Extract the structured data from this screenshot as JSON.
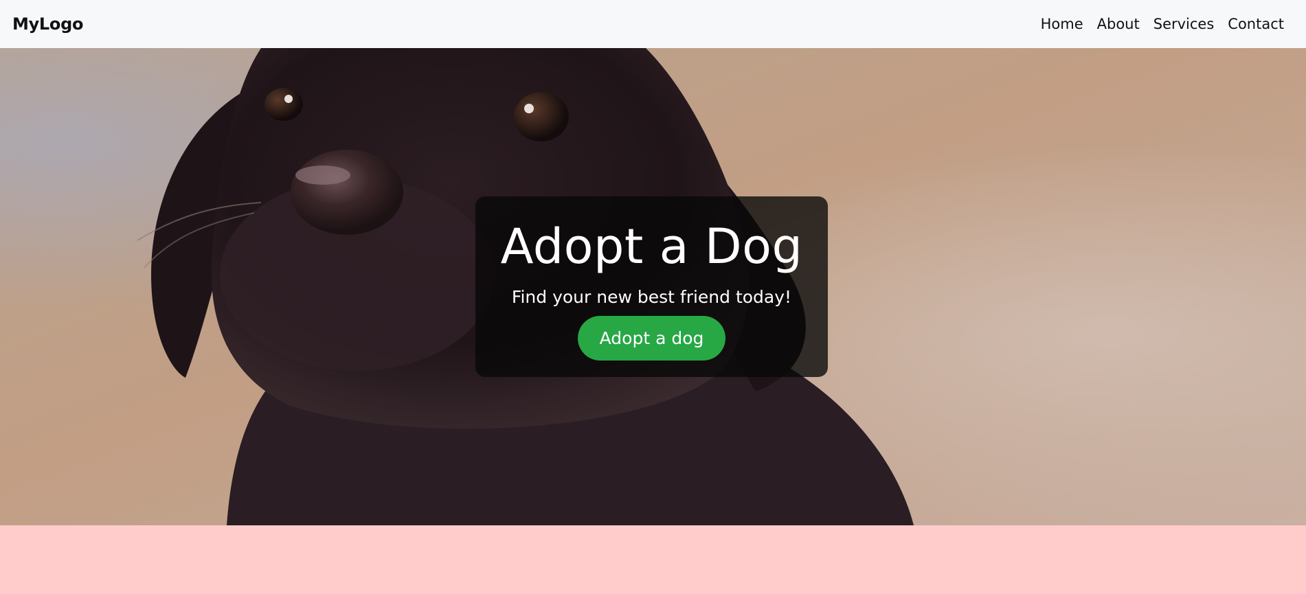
{
  "navbar": {
    "logo": "MyLogo",
    "links": [
      "Home",
      "About",
      "Services",
      "Contact"
    ]
  },
  "hero": {
    "image_alt": "black puppy close-up",
    "title": "Adopt a Dog",
    "subtitle": "Find your new best friend today!",
    "button_label": "Adopt a dog"
  },
  "colors": {
    "navbar_bg": "#f7f8fa",
    "button_bg": "#28a745",
    "card_bg": "rgba(8,8,8,0.78)",
    "page_bottom_bg": "#ffcccb"
  }
}
